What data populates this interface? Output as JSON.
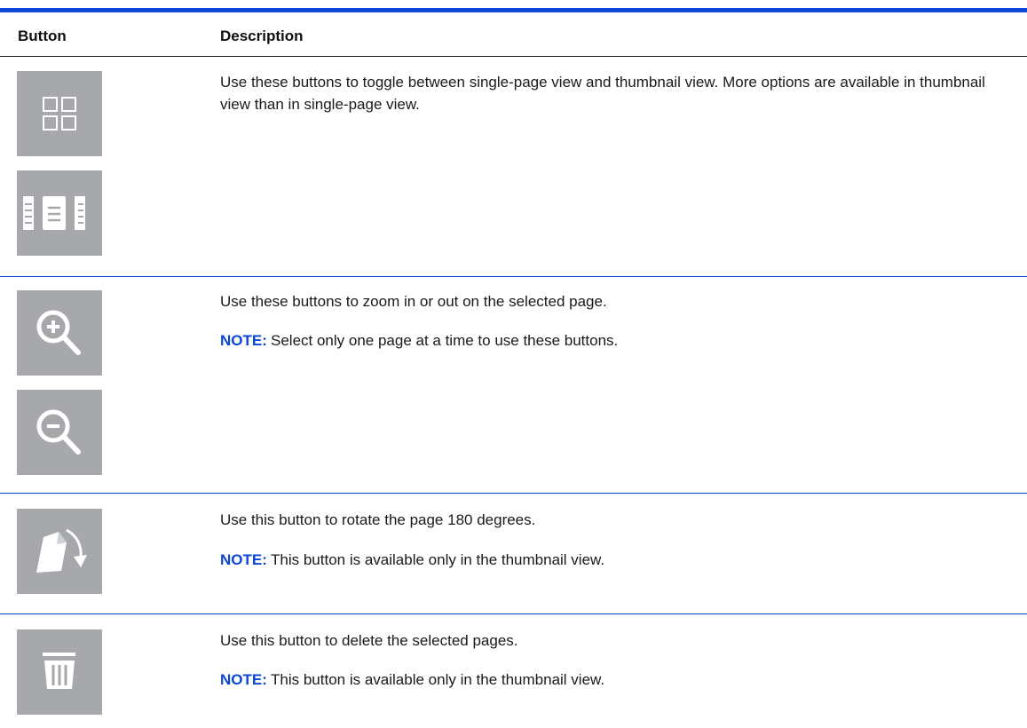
{
  "header": {
    "col_button": "Button",
    "col_description": "Description"
  },
  "rows": [
    {
      "icons": [
        "thumbnail-view-icon",
        "single-page-view-icon"
      ],
      "description": "Use these buttons to toggle between single-page view and thumbnail view. More options are available in thumbnail view than in single-page view."
    },
    {
      "icons": [
        "zoom-in-icon",
        "zoom-out-icon"
      ],
      "description": "Use these buttons to zoom in or out on the selected page.",
      "note_label": "NOTE:",
      "note_text": "Select only one page at a time to use these buttons."
    },
    {
      "icons": [
        "rotate-page-icon"
      ],
      "description": "Use this button to rotate the page 180 degrees.",
      "note_label": "NOTE:",
      "note_text": "This button is available only in the thumbnail view."
    },
    {
      "icons": [
        "delete-trash-icon"
      ],
      "description": "Use this button to delete the selected pages.",
      "note_label": "NOTE:",
      "note_text": "This button is available only in the thumbnail view."
    }
  ],
  "colors": {
    "accent": "#0a47d6",
    "icon_bg": "#a6a8ab",
    "icon_fg": "#ffffff"
  }
}
